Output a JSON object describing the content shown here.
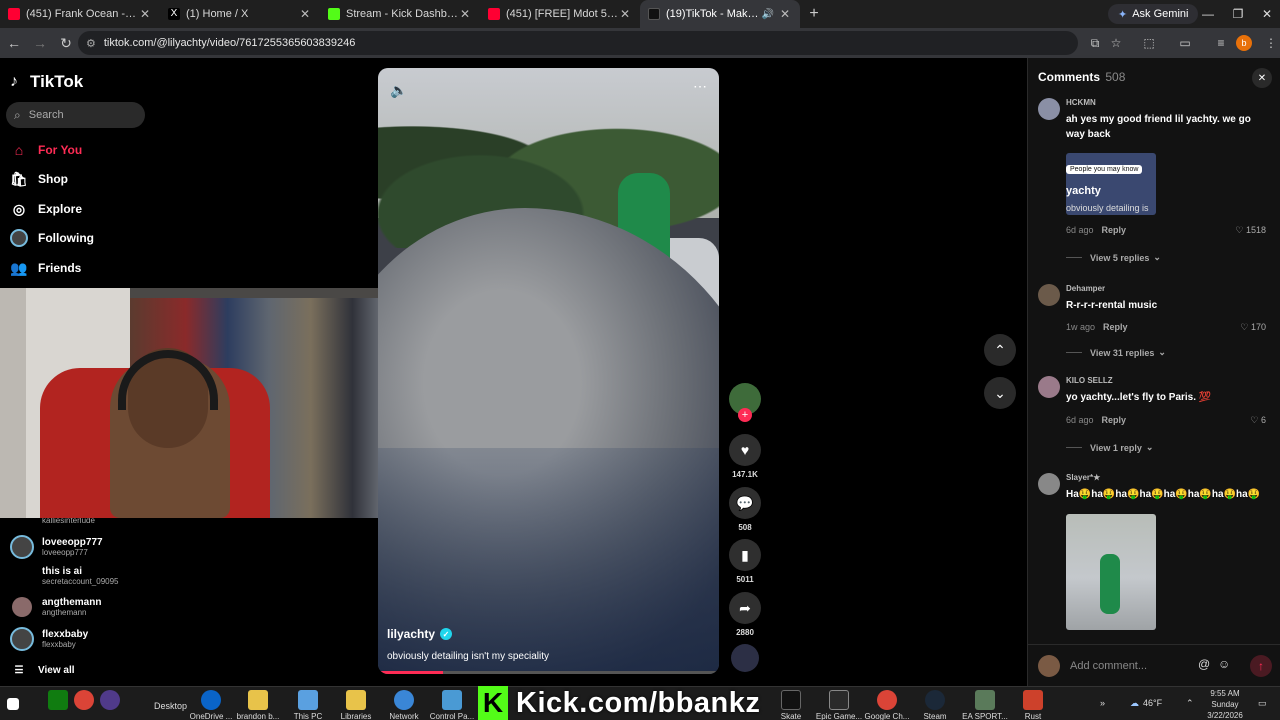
{
  "browser": {
    "tabs": [
      {
        "title": "(451) Frank Ocean - Nights - Yo",
        "color": "#ff0033",
        "active": false
      },
      {
        "title": "(1) Home / X",
        "color": "#ffffff",
        "active": false
      },
      {
        "title": "Stream - Kick Dashboard",
        "color": "#53fc18",
        "active": false
      },
      {
        "title": "(451) [FREE] Mdot 59 x Kdotfrr",
        "color": "#ff0033",
        "active": false
      },
      {
        "title": "(19)TikTok - Make Your Day",
        "color": "#ffffff",
        "active": true
      }
    ],
    "new_tab": "+",
    "ask_gemini": "Ask Gemini",
    "url": "tiktok.com/@lilyachty/video/7617255365603839246"
  },
  "tiktok": {
    "logo": "TikTok",
    "search_placeholder": "Search",
    "nav": [
      {
        "label": "For You",
        "icon": "home-icon",
        "active": true
      },
      {
        "label": "Shop",
        "icon": "shop-icon",
        "active": false
      },
      {
        "label": "Explore",
        "icon": "compass-icon",
        "active": false
      },
      {
        "label": "Following",
        "icon": "following-icon",
        "active": false
      },
      {
        "label": "Friends",
        "icon": "friends-icon",
        "active": false
      }
    ],
    "following": [
      {
        "name": "",
        "handle": "kalliesinterlude"
      },
      {
        "name": "loveeopp777",
        "handle": "loveeopp777"
      },
      {
        "name": "this is ai",
        "handle": "secretaccount_09095"
      },
      {
        "name": "angthemann",
        "handle": "angthemann"
      },
      {
        "name": "flexxbaby",
        "handle": "flexxbaby"
      }
    ],
    "view_all": "View all",
    "video": {
      "author": "lilyachty",
      "caption": "obviously detailing isn't my speciality",
      "progress": 0.19
    },
    "actions": {
      "likes": "147.1K",
      "comments": "508",
      "saves": "5011",
      "shares": "2880"
    }
  },
  "comments_panel": {
    "title": "Comments",
    "count": "508",
    "comments": [
      {
        "user": "HCKMN",
        "text": "ah yes my good friend lil yachty. we go way back",
        "time": "6d ago",
        "reply": "Reply",
        "likes": "1518",
        "replies": "View 5 replies",
        "image": {
          "pill": "People you may know",
          "user": "yachty",
          "sub": "obviously detailing is"
        }
      },
      {
        "user": "Dehamper",
        "text": "R-r-r-r-rental music",
        "time": "1w ago",
        "reply": "Reply",
        "likes": "170",
        "replies": "View 31 replies"
      },
      {
        "user": "KILO SELLZ",
        "text": "yo yachty...let's fly to Paris. 💯",
        "time": "6d ago",
        "reply": "Reply",
        "likes": "6",
        "replies": "View 1 reply"
      },
      {
        "user": "Slayer*★",
        "text": "Ha🤑ha🤑ha🤑ha🤑ha🤑ha🤑ha🤑ha🤑",
        "time": "",
        "reply": "",
        "likes": "",
        "replies": ""
      }
    ],
    "add_placeholder": "Add comment..."
  },
  "taskbar": {
    "desktop": "Desktop",
    "items": [
      "OneDrive ...",
      "brandon b...",
      "This PC",
      "Libraries",
      "Network",
      "Control Pa...",
      "Skate",
      "Epic Game...",
      "Google Ch...",
      "Steam",
      "EA SPORT...",
      "Rust"
    ],
    "overlay": "Kick.com/bbankz",
    "weather": "46°F",
    "time": "9:55 AM",
    "day": "Sunday",
    "date": "3/22/2026"
  }
}
